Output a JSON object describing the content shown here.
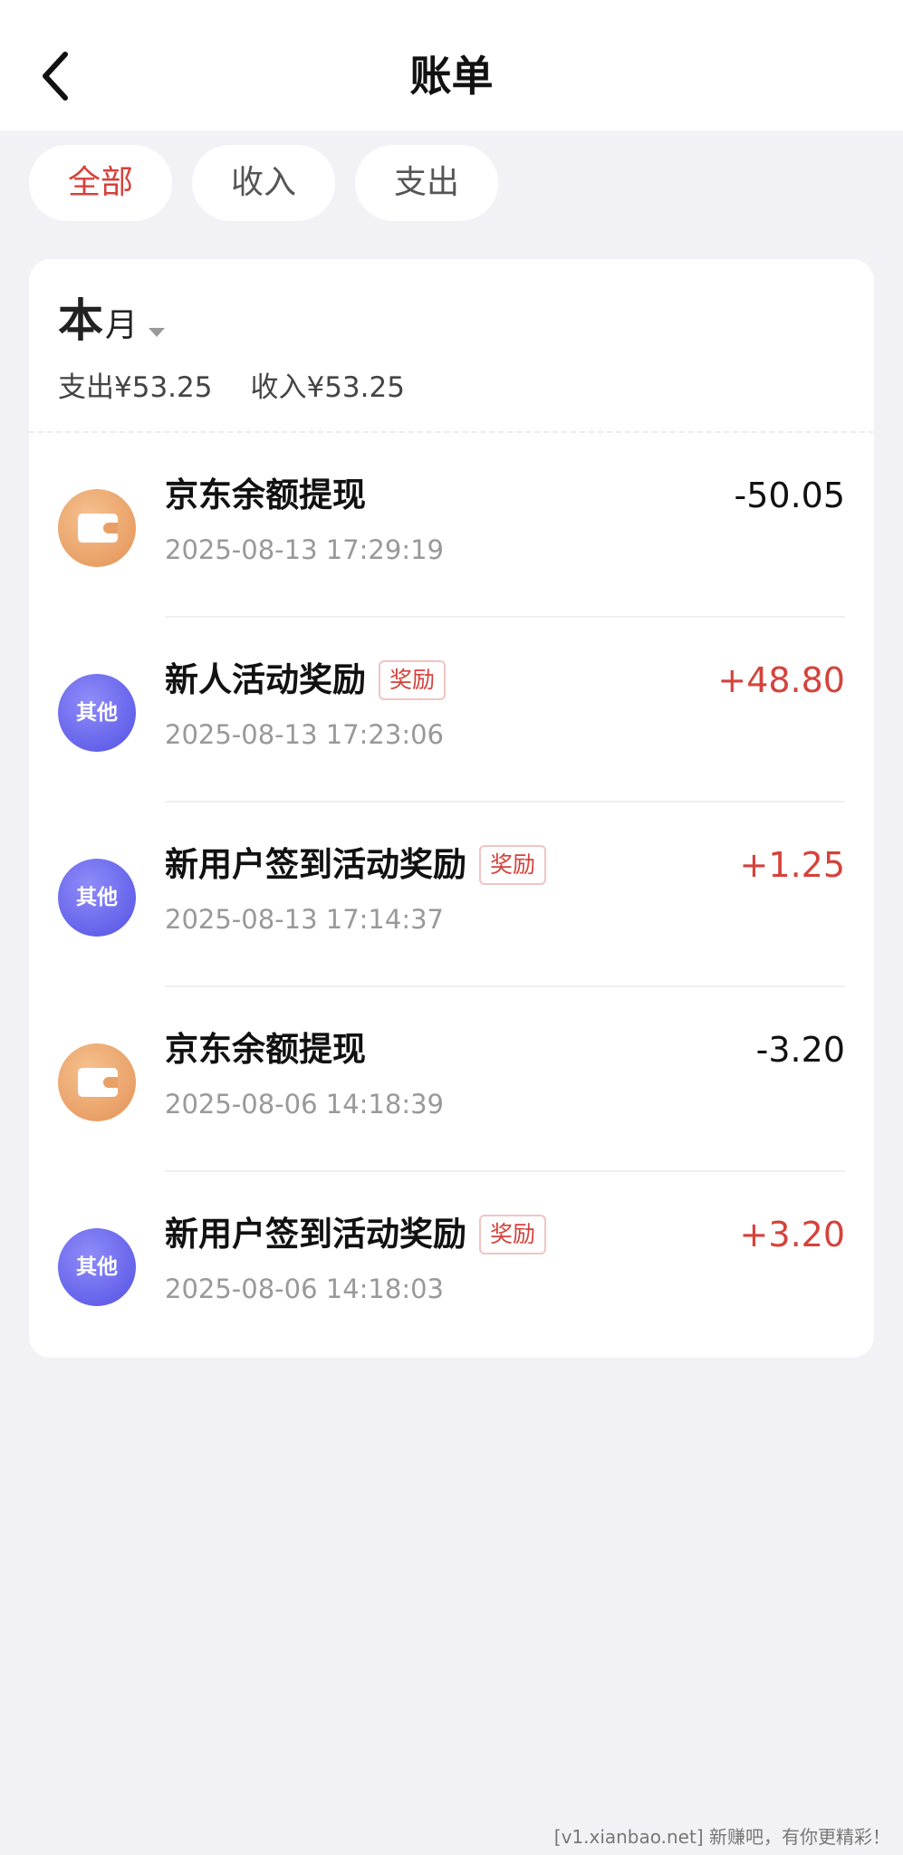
{
  "header": {
    "title": "账单"
  },
  "tabs": [
    {
      "label": "全部",
      "active": true
    },
    {
      "label": "收入",
      "active": false
    },
    {
      "label": "支出",
      "active": false
    }
  ],
  "period": {
    "big": "本",
    "small": "月"
  },
  "summary": {
    "expense": "支出¥53.25",
    "income": "收入¥53.25"
  },
  "transactions": [
    {
      "title": "京东余额提现",
      "tag": "",
      "time": "2025-08-13 17:29:19",
      "amount": "-50.05",
      "icon": "wallet-icon",
      "icon_text": ""
    },
    {
      "title": "新人活动奖励",
      "tag": "奖励",
      "time": "2025-08-13 17:23:06",
      "amount": "+48.80",
      "icon": "other-icon",
      "icon_text": "其他"
    },
    {
      "title": "新用户签到活动奖励",
      "tag": "奖励",
      "time": "2025-08-13 17:14:37",
      "amount": "+1.25",
      "icon": "other-icon",
      "icon_text": "其他"
    },
    {
      "title": "京东余额提现",
      "tag": "",
      "time": "2025-08-06 14:18:39",
      "amount": "-3.20",
      "icon": "wallet-icon",
      "icon_text": ""
    },
    {
      "title": "新用户签到活动奖励",
      "tag": "奖励",
      "time": "2025-08-06 14:18:03",
      "amount": "+3.20",
      "icon": "other-icon",
      "icon_text": "其他"
    }
  ],
  "watermark": "[v1.xianbao.net] 新赚吧，有你更精彩！",
  "colors": {
    "accent_red": "#d5423b",
    "wallet_orange": "#e9a067",
    "other_purple": "#6563ea",
    "background": "#f2f2f6"
  }
}
